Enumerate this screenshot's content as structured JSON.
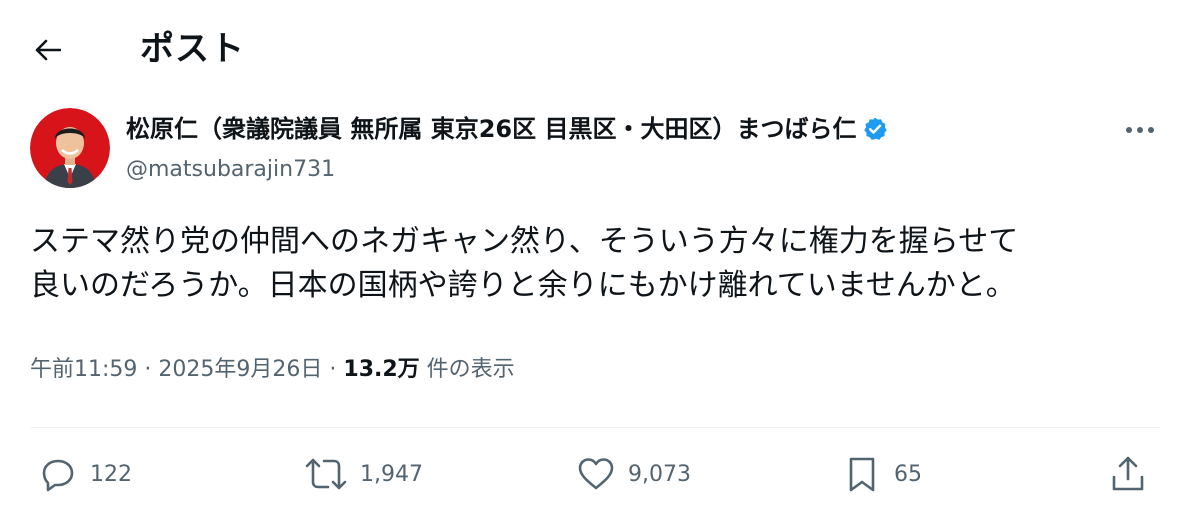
{
  "header": {
    "back_icon": "arrow-left-icon",
    "title": "ポスト"
  },
  "author": {
    "display_name": "松原仁（衆議院議員 無所属 東京26区 目黒区・大田区）まつばら仁",
    "handle": "@matsubarajin731",
    "verified": true,
    "verified_color": "#1d9bf0",
    "more_icon": "more-horizontal-icon"
  },
  "tweet": {
    "text": "ステマ然り党の仲間へのネガキャン然り、そういう方々に権力を握らせて\n良いのだろうか。日本の国柄や誇りと余りにもかけ離れていませんかと。"
  },
  "meta": {
    "time": "午前11:59",
    "separator": "·",
    "date": "2025年9月26日",
    "views": "13.2万",
    "views_label": "件の表示"
  },
  "actions": {
    "replies": "122",
    "retweets": "1,947",
    "likes": "9,073",
    "bookmarks": "65"
  },
  "colors": {
    "text": "#0f1419",
    "secondary": "#536471",
    "divider": "#eff3f4",
    "accent": "#1d9bf0"
  }
}
